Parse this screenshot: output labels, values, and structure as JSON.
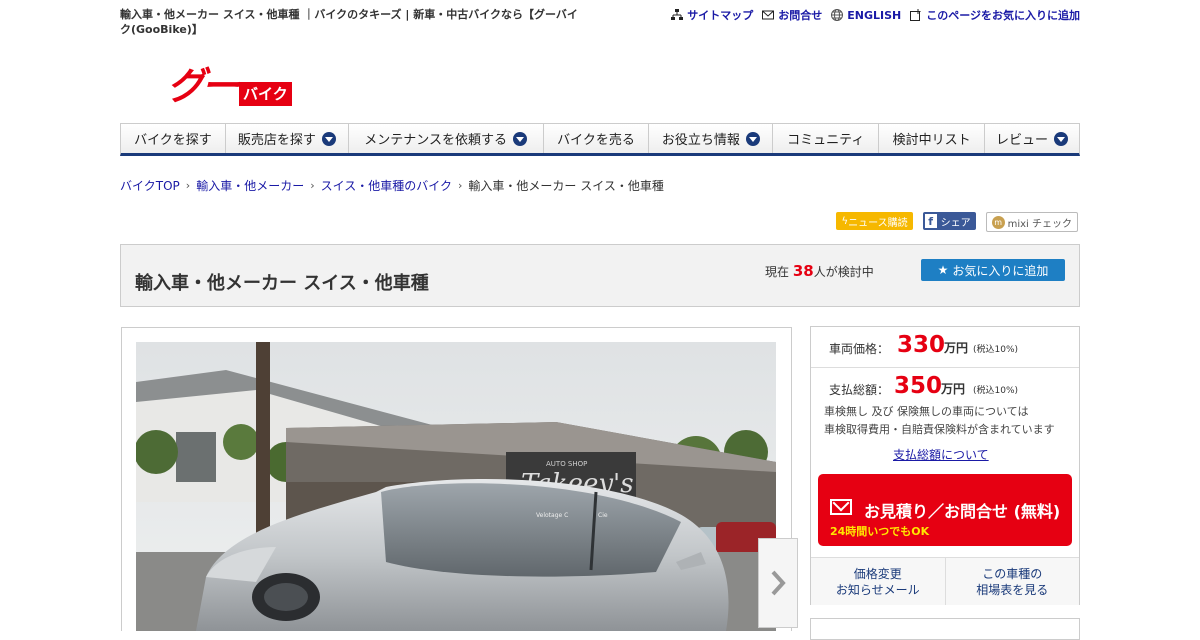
{
  "header": {
    "site_title": "輸入車・他メーカー スイス・他車種 ｜バイクのタキーズ | 新車・中古バイクなら【グーバイク(GooBike)】",
    "links": [
      {
        "label": "サイトマップ",
        "icon": "sitemap-icon"
      },
      {
        "label": "お問合せ",
        "icon": "mail-icon"
      },
      {
        "label": "ENGLISH",
        "icon": "globe-icon"
      },
      {
        "label": "このページをお気に入りに追加",
        "icon": "bookmark-add-icon"
      }
    ],
    "logo_main": "グー",
    "logo_sub": "バイク"
  },
  "nav": {
    "items": [
      {
        "label": "バイクを探す",
        "dropdown": false
      },
      {
        "label": "販売店を探す",
        "dropdown": true
      },
      {
        "label": "メンテナンスを依頼する",
        "dropdown": true
      },
      {
        "label": "バイクを売る",
        "dropdown": false
      },
      {
        "label": "お役立ち情報",
        "dropdown": true
      },
      {
        "label": "コミュニティ",
        "dropdown": false
      },
      {
        "label": "検討中リスト",
        "dropdown": false
      },
      {
        "label": "レビュー",
        "dropdown": true
      }
    ]
  },
  "breadcrumb": {
    "items": [
      "バイクTOP",
      "輸入車・他メーカー",
      "スイス・他車種のバイク"
    ],
    "current": "輸入車・他メーカー スイス・他車種"
  },
  "social": {
    "news": "ニュース購読",
    "facebook": "シェア",
    "mixi": "mixi チェック"
  },
  "title_box": {
    "title": "輸入車・他メーカー スイス・他車種",
    "count_prefix": "現在",
    "count": "38",
    "count_suffix": "人が検討中",
    "fav_button": "お気に入りに追加"
  },
  "price": {
    "vehicle_label": "車両価格：",
    "vehicle_value": "330",
    "vehicle_unit": "万円",
    "vehicle_tax": "(税込10%)",
    "total_label": "支払総額：",
    "total_value": "350",
    "total_unit": "万円",
    "total_tax": "(税込10%)",
    "note_line1": "車検無し 及び 保険無しの車両については",
    "note_line2": "車検取得費用・自賠責保険料が含まれています",
    "about_link": "支払総額について",
    "cta_title": "お見積り／お問合せ (無料)",
    "cta_sub": "24時間いつでもOK",
    "btn_price_alert_1": "価格変更",
    "btn_price_alert_2": "お知らせメール",
    "btn_market_1": "この車種の",
    "btn_market_2": "相場表を見る"
  },
  "photo": {
    "sign_text": "Takeey's",
    "sign_small": "AUTO SHOP",
    "label_left": "Velotage C",
    "label_right": "Cie"
  },
  "colors": {
    "accent_red": "#e60012",
    "nav_blue": "#1a3a7a",
    "button_blue": "#1e7fc4"
  }
}
